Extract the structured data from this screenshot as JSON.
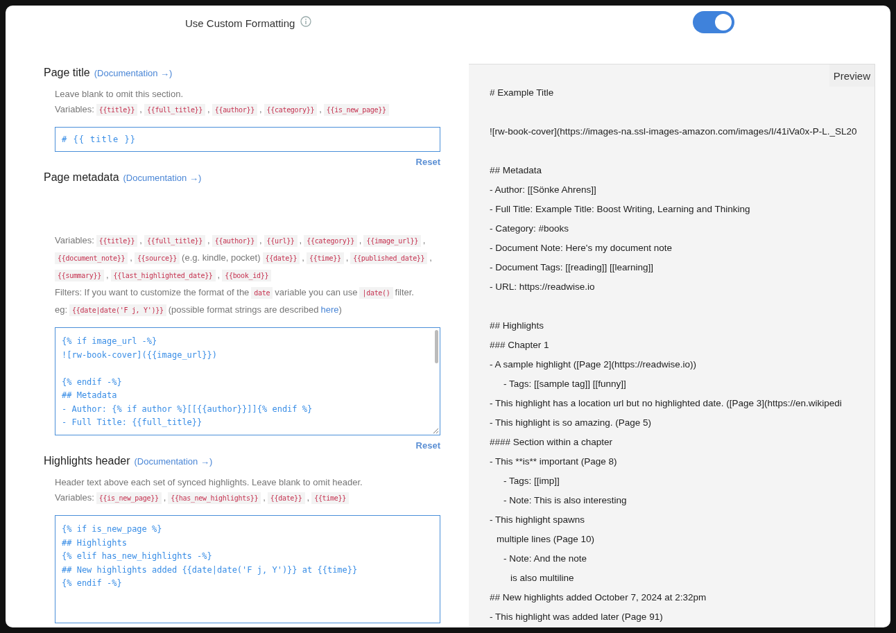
{
  "custom_formatting": {
    "label": "Use Custom Formatting",
    "on": true
  },
  "sections": [
    {
      "title": "Page title",
      "doc_link": "(Documentation →)",
      "description": "Leave blank to omit this section.",
      "help": [
        [
          {
            "kind": "text",
            "text": "Variables:"
          },
          {
            "kind": "code",
            "text": "{{title}}"
          },
          {
            "kind": "text",
            "text": ","
          },
          {
            "kind": "code",
            "text": "{{full_title}}"
          },
          {
            "kind": "text",
            "text": ","
          },
          {
            "kind": "code",
            "text": "{{author}}"
          },
          {
            "kind": "text",
            "text": ","
          },
          {
            "kind": "code",
            "text": "{{category}}"
          },
          {
            "kind": "text",
            "text": ","
          },
          {
            "kind": "code",
            "text": "{{is_new_page}}"
          }
        ]
      ],
      "field": {
        "kind": "input",
        "value": "# {{ title }}"
      },
      "reset": "Reset"
    },
    {
      "title": "Page metadata",
      "doc_link": "(Documentation →)",
      "help": [
        [
          {
            "kind": "text",
            "text": "Variables:"
          },
          {
            "kind": "code",
            "text": "{{title}}"
          },
          {
            "kind": "text",
            "text": ","
          },
          {
            "kind": "code",
            "text": "{{full_title}}"
          },
          {
            "kind": "text",
            "text": ","
          },
          {
            "kind": "code",
            "text": "{{author}}"
          },
          {
            "kind": "text",
            "text": ","
          },
          {
            "kind": "code",
            "text": "{{url}}"
          },
          {
            "kind": "text",
            "text": ","
          },
          {
            "kind": "code",
            "text": "{{category}}"
          },
          {
            "kind": "text",
            "text": ","
          },
          {
            "kind": "code",
            "text": "{{image_url}}"
          },
          {
            "kind": "text",
            "text": ","
          },
          {
            "kind": "code",
            "text": "{{document_note}}"
          },
          {
            "kind": "text",
            "text": ","
          },
          {
            "kind": "code",
            "text": "{{source}}"
          },
          {
            "kind": "text",
            "text": "(e.g. kindle, pocket)"
          },
          {
            "kind": "code",
            "text": "{{date}}"
          },
          {
            "kind": "text",
            "text": ","
          },
          {
            "kind": "code",
            "text": "{{time}}"
          },
          {
            "kind": "text",
            "text": ","
          },
          {
            "kind": "code",
            "text": "{{published_date}}"
          },
          {
            "kind": "text",
            "text": ","
          },
          {
            "kind": "code",
            "text": "{{summary}}"
          },
          {
            "kind": "text",
            "text": ","
          },
          {
            "kind": "code",
            "text": "{{last_highlighted_date}}"
          },
          {
            "kind": "text",
            "text": ","
          },
          {
            "kind": "code",
            "text": "{{book_id}}"
          }
        ],
        [
          {
            "kind": "text",
            "text": "Filters: If you want to customize the format of the"
          },
          {
            "kind": "code",
            "text": "date"
          },
          {
            "kind": "text",
            "text": "variable you can use"
          },
          {
            "kind": "code",
            "text": "|date()"
          },
          {
            "kind": "text",
            "text": "filter."
          }
        ],
        [
          {
            "kind": "text",
            "text": "eg:"
          },
          {
            "kind": "code",
            "text": "{{date|date('F j, Y')}}"
          },
          {
            "kind": "text",
            "text": "(possible format strings are described"
          },
          {
            "kind": "link",
            "text": "here"
          },
          {
            "kind": "text",
            "text": ")"
          }
        ]
      ],
      "field": {
        "kind": "textarea",
        "scrollable": true,
        "blocks": [
          [
            "{% if image_url -%}",
            "![rw-book-cover]({{image_url}})"
          ],
          [
            "{% endif -%}",
            "## Metadata",
            "- Author: {% if author %}[[{{author}}]]{% endif %}",
            "- Full Title: {{full_title}}"
          ]
        ]
      },
      "reset": "Reset"
    },
    {
      "title": "Highlights header",
      "doc_link": "(Documentation →)",
      "description": "Header text above each set of synced highlights. Leave blank to omit header.",
      "help": [
        [
          {
            "kind": "text",
            "text": "Variables:"
          },
          {
            "kind": "code",
            "text": "{{is_new_page}}"
          },
          {
            "kind": "text",
            "text": ","
          },
          {
            "kind": "code",
            "text": "{{has_new_highlights}}"
          },
          {
            "kind": "text",
            "text": ","
          },
          {
            "kind": "code",
            "text": "{{date}}"
          },
          {
            "kind": "text",
            "text": ","
          },
          {
            "kind": "code",
            "text": "{{time}}"
          }
        ]
      ],
      "field": {
        "kind": "textarea",
        "blocks": [
          [
            "{% if is_new_page %}",
            "## Highlights",
            "{% elif has_new_highlights -%}",
            "## New highlights added {{date|date('F j, Y')}} at {{time}}",
            "{% endif -%}"
          ]
        ]
      }
    }
  ],
  "preview": {
    "tab": "Preview",
    "items": [
      {
        "lines": [
          "# Example Title"
        ]
      },
      {
        "kind": "blank"
      },
      {
        "lines": [
          "![rw-book-cover](https://images-na.ssl-images-amazon.com/images/I/41iVa0x-P-L._SL20"
        ]
      },
      {
        "kind": "blank"
      },
      {
        "lines": [
          "## Metadata"
        ]
      },
      {
        "lines": [
          "- Author: [[Sönke Ahrens]]"
        ]
      },
      {
        "lines": [
          "- Full Title: Example Title: Boost Writing, Learning and Thinking"
        ]
      },
      {
        "lines": [
          "- Category: #books"
        ]
      },
      {
        "lines": [
          "- Document Note: Here's my document note"
        ]
      },
      {
        "lines": [
          "- Document Tags: [[reading]] [[learning]]"
        ]
      },
      {
        "lines": [
          "- URL: https://readwise.io"
        ]
      },
      {
        "kind": "blank"
      },
      {
        "lines": [
          "## Highlights"
        ]
      },
      {
        "lines": [
          "### Chapter 1"
        ]
      },
      {
        "lines": [
          "- A sample highlight ([Page 2](https://readwise.io))"
        ],
        "children": [
          {
            "lines": [
              "- Tags: [[sample tag]] [[funny]]"
            ]
          }
        ]
      },
      {
        "lines": [
          "- This highlight has a location url but no highlighted date. ([Page 3](https://en.wikipedi"
        ]
      },
      {
        "lines": [
          "- This highlight is so amazing. (Page 5)"
        ]
      },
      {
        "lines": [
          "#### Section within a chapter"
        ]
      },
      {
        "lines": [
          "- This **is** important (Page 8)"
        ],
        "children": [
          {
            "lines": [
              "- Tags: [[imp]]"
            ]
          },
          {
            "lines": [
              "- Note: This is also interesting"
            ]
          }
        ]
      },
      {
        "lines": [
          "- This highlight spawns",
          "multiple lines (Page 10)"
        ],
        "children": [
          {
            "lines": [
              "- Note: And the note",
              "is also multiline"
            ]
          }
        ]
      },
      {
        "lines": [
          "## New highlights added October 7, 2024 at 2:32pm"
        ]
      },
      {
        "lines": [
          "- This highlight was added later (Page 91)"
        ]
      }
    ]
  }
}
